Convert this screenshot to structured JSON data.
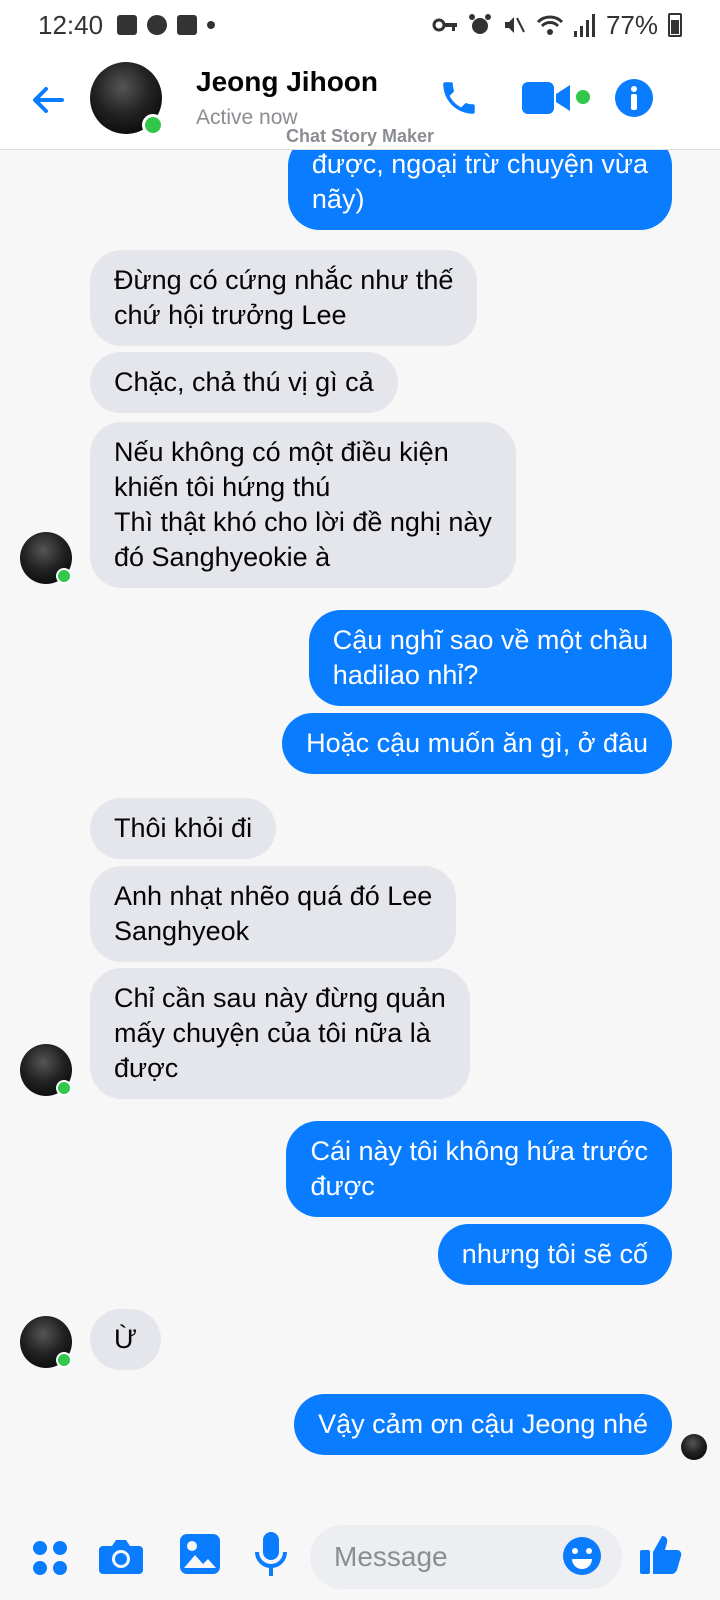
{
  "status_bar": {
    "time": "12:40",
    "battery": "77%"
  },
  "header": {
    "contact_name": "Jeong Jihoon",
    "status": "Active now",
    "watermark": "Chat Story Maker"
  },
  "messages": [
    {
      "side": "out",
      "text": "được, ngoại trừ chuyện vừa\nnãy)"
    },
    {
      "side": "in",
      "text": "Đừng có cứng nhắc như thế\nchứ hội trưởng Lee"
    },
    {
      "side": "in",
      "text": "Chặc, chả thú vị gì cả"
    },
    {
      "side": "in",
      "text": "Nếu không có một điều kiện\nkhiến tôi hứng thú\nThì thật khó cho lời đề nghị này\nđó Sanghyeokie à"
    },
    {
      "side": "out",
      "text": "Cậu nghĩ sao về một chầu\nhadilao nhỉ?"
    },
    {
      "side": "out",
      "text": "Hoặc cậu muốn ăn gì, ở đâu"
    },
    {
      "side": "in",
      "text": "Thôi khỏi đi"
    },
    {
      "side": "in",
      "text": "Anh nhạt nhẽo quá đó Lee\nSanghyeok"
    },
    {
      "side": "in",
      "text": "Chỉ cần sau này đừng quản\nmấy chuyện của tôi nữa là\nđược"
    },
    {
      "side": "out",
      "text": "Cái này tôi không hứa trước\nđược"
    },
    {
      "side": "out",
      "text": "nhưng tôi sẽ cố"
    },
    {
      "side": "in",
      "text": "Ừ"
    },
    {
      "side": "out",
      "text": "Vậy cảm ơn cậu Jeong nhé"
    }
  ],
  "composer": {
    "placeholder": "Message"
  },
  "colors": {
    "accent": "#0a7cff",
    "incoming_bubble": "#e4e6eb",
    "online": "#31c74a"
  },
  "icons": [
    "back-arrow-icon",
    "phone-icon",
    "video-icon",
    "info-icon",
    "apps-icon",
    "camera-icon",
    "gallery-icon",
    "mic-icon",
    "emoji-icon",
    "like-icon"
  ]
}
